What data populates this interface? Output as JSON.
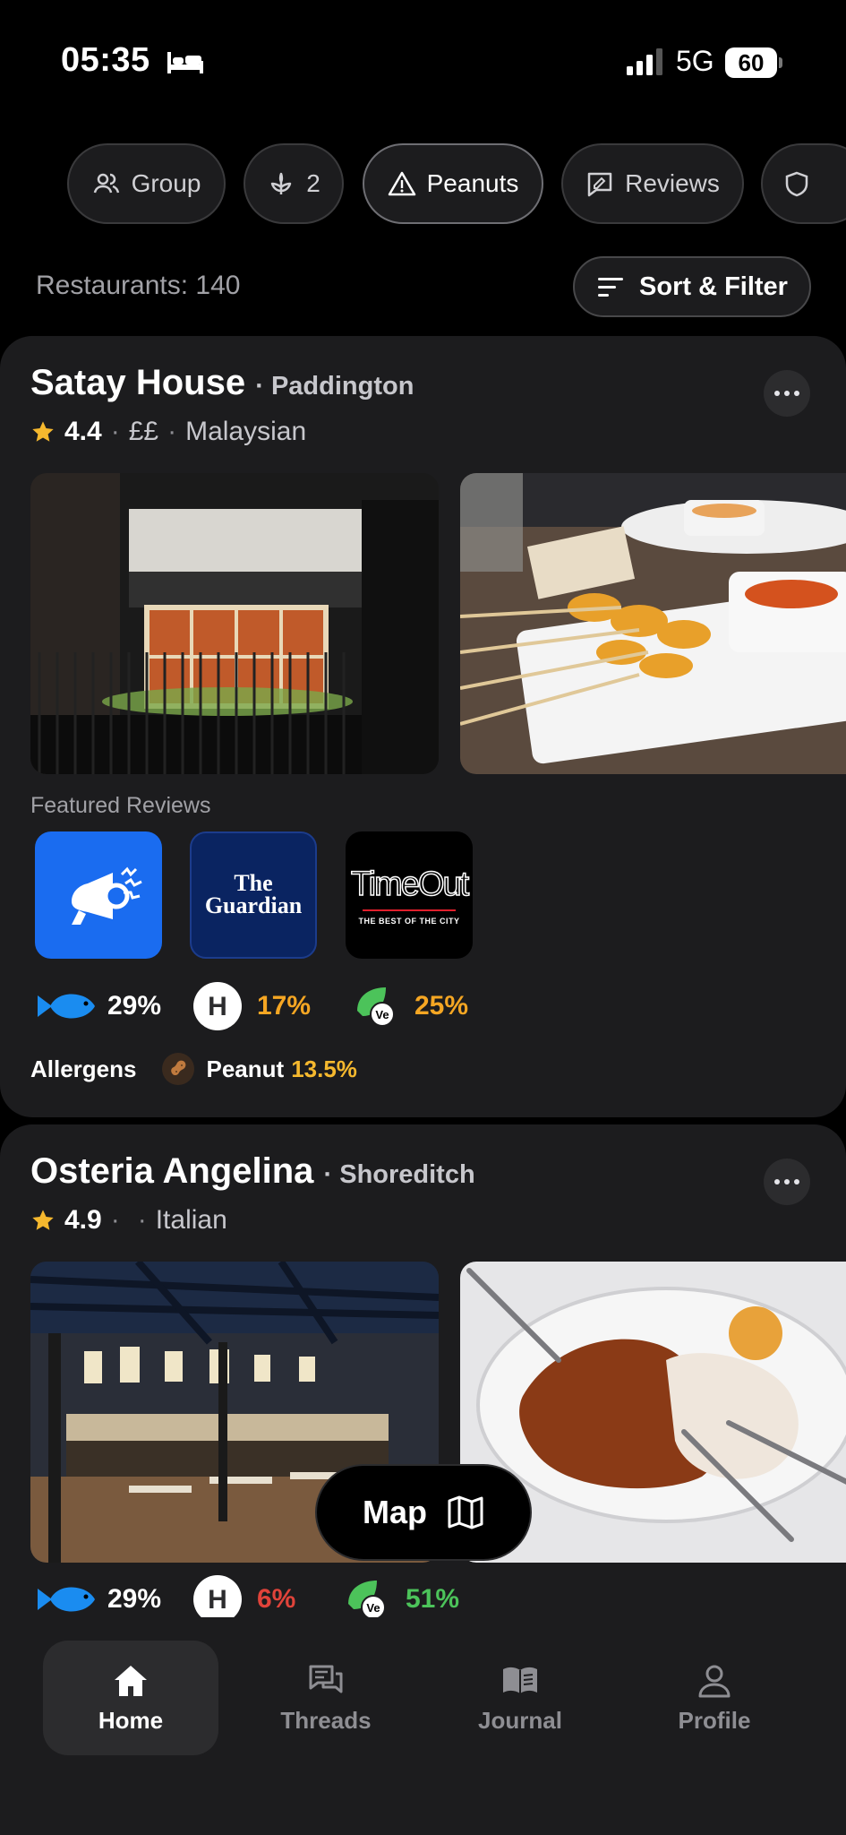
{
  "status": {
    "time": "05:35",
    "network": "5G",
    "battery": "60"
  },
  "chips": [
    {
      "label": "Group",
      "icon": "people-icon"
    },
    {
      "label": "2",
      "icon": "diet-icon"
    },
    {
      "label": "Peanuts",
      "icon": "warning-icon"
    },
    {
      "label": "Reviews",
      "icon": "review-icon"
    }
  ],
  "list": {
    "count_label": "Restaurants: 140",
    "sort_label": "Sort & Filter"
  },
  "restaurants": [
    {
      "name": "Satay House",
      "area": "· Paddington",
      "rating": "4.4",
      "price": "££",
      "cuisine": "Malaysian",
      "featured_label": "Featured Reviews",
      "reviews": [
        "megaphone-logo",
        "The Guardian",
        "Time Out"
      ],
      "scores": [
        {
          "icon": "fish-icon",
          "value": "29%",
          "color": "#ffffff"
        },
        {
          "icon": "halal-icon",
          "value": "17%",
          "color": "#f5a623"
        },
        {
          "icon": "vegan-icon",
          "value": "25%",
          "color": "#f5a623"
        }
      ],
      "allergens_label": "Allergens",
      "allergen": {
        "name": "Peanut",
        "value": "13.5%",
        "color": "#f5b82e"
      }
    },
    {
      "name": "Osteria Angelina",
      "area": "· Shoreditch",
      "rating": "4.9",
      "price": "",
      "cuisine": "Italian",
      "scores": [
        {
          "icon": "fish-icon",
          "value": "29%",
          "color": "#ffffff"
        },
        {
          "icon": "halal-icon",
          "value": "6%",
          "color": "#e0433a"
        },
        {
          "icon": "vegan-icon",
          "value": "51%",
          "color": "#4cc35a"
        }
      ]
    }
  ],
  "map_label": "Map",
  "tabs": [
    {
      "label": "Home",
      "active": true
    },
    {
      "label": "Threads"
    },
    {
      "label": "Journal"
    },
    {
      "label": "Profile"
    }
  ],
  "guardian": {
    "the": "The",
    "name": "Guardian"
  },
  "timeout": {
    "name": "TimeOut",
    "tagline": "THE BEST OF THE CITY"
  },
  "colors": {
    "accent_orange": "#f5a623",
    "star": "#f5b82e",
    "card_bg": "#1c1c1e"
  }
}
